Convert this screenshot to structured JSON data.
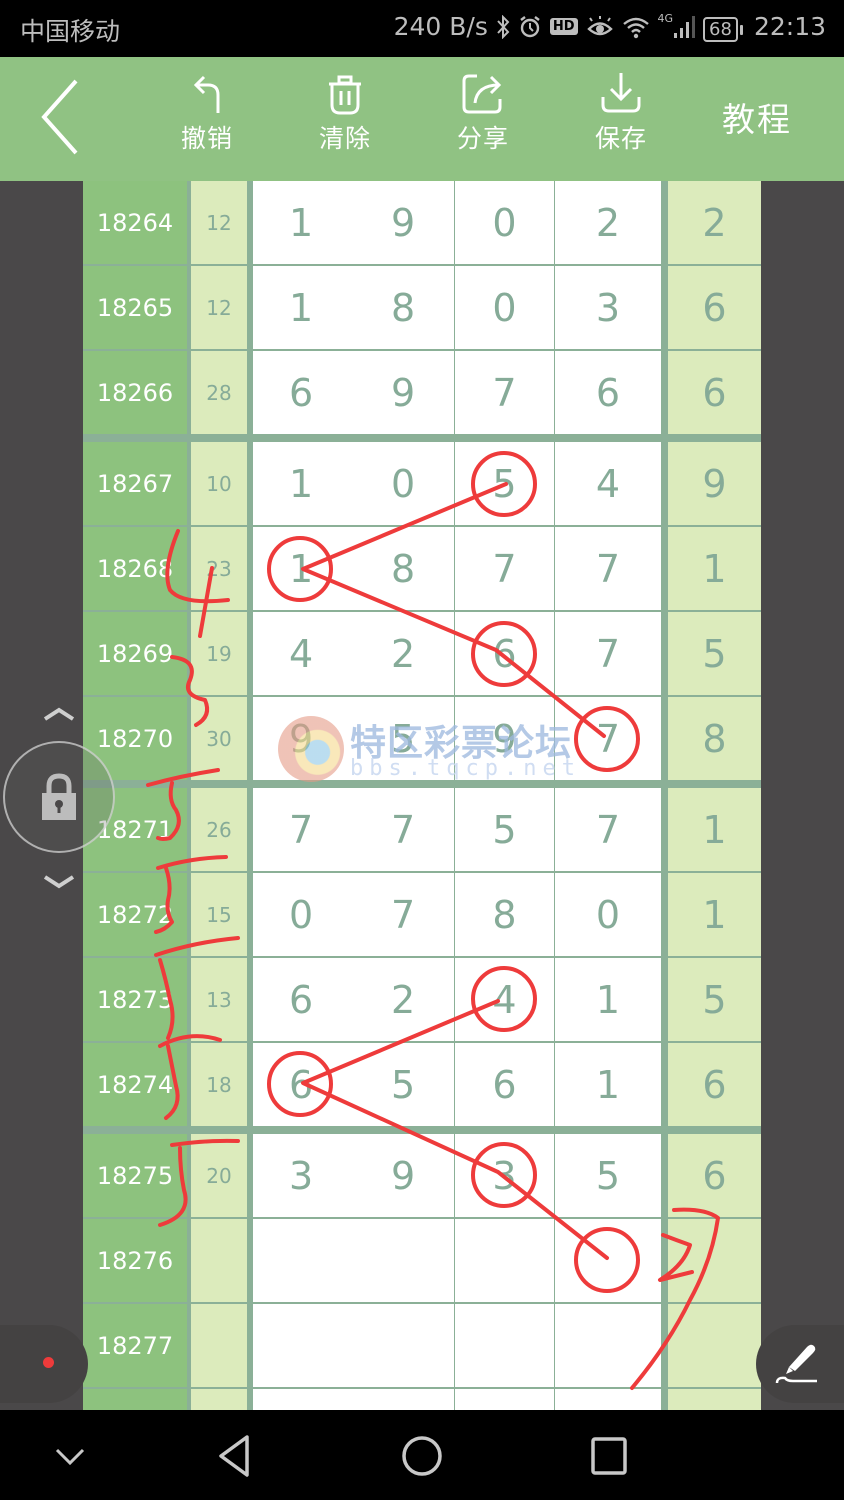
{
  "status_bar": {
    "carrier": "中国移动",
    "net_speed": "240 B/s",
    "icons": [
      "bluetooth-icon",
      "alarm-icon",
      "hd-icon",
      "eye-comfort-icon",
      "wifi-icon",
      "4g-signal-icon"
    ],
    "hd_label": "HD",
    "network_type": "4G",
    "battery": "68",
    "time": "22:13"
  },
  "toolbar": {
    "back_icon": "chevron-left-icon",
    "items": [
      {
        "label": "撤销",
        "icon": "undo-icon"
      },
      {
        "label": "清除",
        "icon": "trash-icon"
      },
      {
        "label": "分享",
        "icon": "share-icon"
      },
      {
        "label": "保存",
        "icon": "download-icon"
      }
    ],
    "tutorial_label": "教程"
  },
  "colors": {
    "toolbar_bg": "#90c283",
    "issue_col_bg": "#8dc27e",
    "sum_col_bg": "#dcebbc",
    "grid_border": "#8bb097",
    "digit_text": "#86ab98",
    "annotation_red": "#ee3b3b",
    "side_bg": "#4a4849"
  },
  "table": {
    "rows": [
      {
        "issue": "18264",
        "sum": "12",
        "digits": [
          "1",
          "9",
          "0",
          "2"
        ],
        "last": "2",
        "group_start": true
      },
      {
        "issue": "18265",
        "sum": "12",
        "digits": [
          "1",
          "8",
          "0",
          "3"
        ],
        "last": "6"
      },
      {
        "issue": "18266",
        "sum": "28",
        "digits": [
          "6",
          "9",
          "7",
          "6"
        ],
        "last": "6"
      },
      {
        "issue": "18267",
        "sum": "10",
        "digits": [
          "1",
          "0",
          "5",
          "4"
        ],
        "last": "9",
        "group_start": true
      },
      {
        "issue": "18268",
        "sum": "23",
        "digits": [
          "1",
          "8",
          "7",
          "7"
        ],
        "last": "1"
      },
      {
        "issue": "18269",
        "sum": "19",
        "digits": [
          "4",
          "2",
          "6",
          "7"
        ],
        "last": "5"
      },
      {
        "issue": "18270",
        "sum": "30",
        "digits": [
          "9",
          "5",
          "9",
          "7"
        ],
        "last": "8"
      },
      {
        "issue": "18271",
        "sum": "26",
        "digits": [
          "7",
          "7",
          "5",
          "7"
        ],
        "last": "1",
        "group_start": true
      },
      {
        "issue": "18272",
        "sum": "15",
        "digits": [
          "0",
          "7",
          "8",
          "0"
        ],
        "last": "1"
      },
      {
        "issue": "18273",
        "sum": "13",
        "digits": [
          "6",
          "2",
          "4",
          "1"
        ],
        "last": "5"
      },
      {
        "issue": "18274",
        "sum": "18",
        "digits": [
          "6",
          "5",
          "6",
          "1"
        ],
        "last": "6"
      },
      {
        "issue": "18275",
        "sum": "20",
        "digits": [
          "3",
          "9",
          "3",
          "5"
        ],
        "last": "6",
        "group_start": true
      },
      {
        "issue": "18276",
        "sum": "",
        "digits": [
          "",
          "",
          "",
          ""
        ],
        "last": ""
      },
      {
        "issue": "18277",
        "sum": "",
        "digits": [
          "",
          "",
          "",
          ""
        ],
        "last": ""
      },
      {
        "issue": "",
        "sum": "",
        "digits": [
          "",
          "",
          "",
          ""
        ],
        "last": ""
      }
    ]
  },
  "annotations": {
    "circled_cells": [
      {
        "issue": "18267",
        "digit_index": 2,
        "value": "5"
      },
      {
        "issue": "18268",
        "digit_index": 0,
        "value": "1"
      },
      {
        "issue": "18269",
        "digit_index": 2,
        "value": "6"
      },
      {
        "issue": "18270",
        "digit_index": 3,
        "value": "7"
      },
      {
        "issue": "18273",
        "digit_index": 2,
        "value": "4"
      },
      {
        "issue": "18274",
        "digit_index": 0,
        "value": "6"
      },
      {
        "issue": "18275",
        "digit_index": 2,
        "value": "3"
      },
      {
        "issue": "18276",
        "digit_index": 3,
        "value": ""
      }
    ],
    "handwritten_marks": [
      "4",
      "3",
      "5",
      "5",
      "5",
      "5",
      "5",
      "2"
    ]
  },
  "watermark": {
    "title": "特区彩票论坛",
    "url": "bbs.tqcp.net"
  },
  "floating_controls": {
    "lock_icon": "lock-icon",
    "scroll_up_icon": "chevron-up-icon",
    "scroll_down_icon": "chevron-down-icon",
    "pen_icon": "pen-icon",
    "record_dot_icon": "record-dot-icon"
  },
  "nav_bar": {
    "items": [
      "hide-nav-icon",
      "back-triangle-icon",
      "home-circle-icon",
      "recents-square-icon"
    ]
  }
}
